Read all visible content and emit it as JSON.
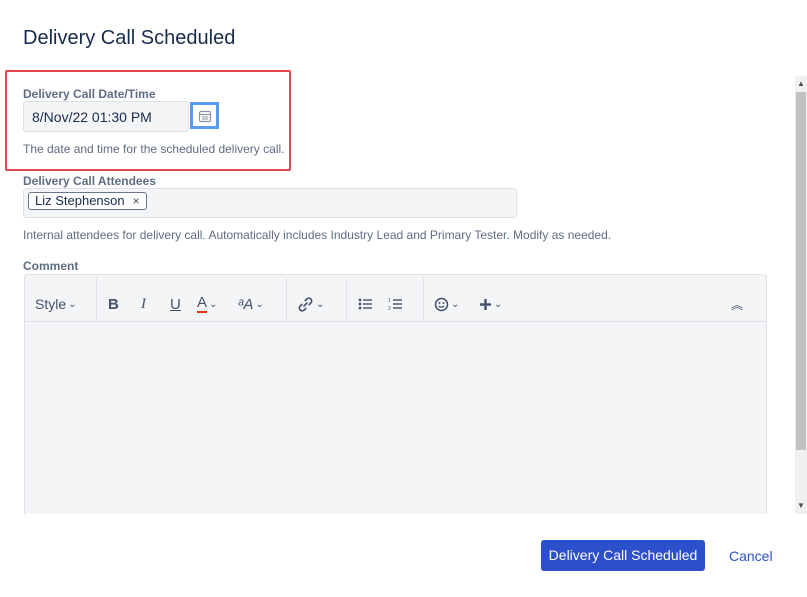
{
  "dialog": {
    "title": "Delivery Call Scheduled"
  },
  "date_field": {
    "label": "Delivery Call Date/Time",
    "value": "8/Nov/22 01:30 PM",
    "help": "The date and time for the scheduled delivery call.",
    "icon": "calendar-icon"
  },
  "attendees_field": {
    "label": "Delivery Call Attendees",
    "chips": [
      {
        "name": "Liz Stephenson",
        "remove": "×"
      }
    ],
    "help": "Internal attendees for delivery call. Automatically includes Industry Lead and Primary Tester. Modify as needed."
  },
  "comment_field": {
    "label": "Comment",
    "toolbar": {
      "style_label": "Style",
      "bold": "B",
      "italic": "I",
      "underline": "U",
      "text_color": "A",
      "more_formatting": "ᵃA",
      "chevron": "⌄",
      "collapse": "︽"
    }
  },
  "footer": {
    "submit_label": "Delivery Call Scheduled",
    "cancel_label": "Cancel"
  },
  "colors": {
    "primary": "#2c4fcc",
    "highlight_red": "#e5484d",
    "focus_blue": "#5b9bf5",
    "text_color_underline": "#de350b"
  }
}
